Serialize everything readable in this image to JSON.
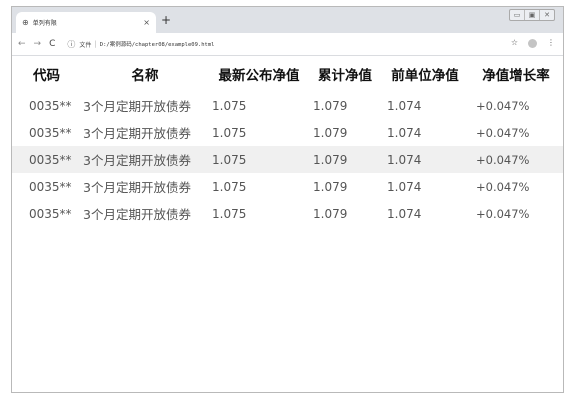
{
  "browser": {
    "tab_title": "单列有限",
    "tab_close": "×",
    "new_tab": "+",
    "url_label": "文件",
    "url": "D:/案例源码/chapter08/example09.html"
  },
  "table": {
    "headers": [
      "代码",
      "名称",
      "最新公布净值",
      "累计净值",
      "前单位净值",
      "净值增长率"
    ],
    "rows": [
      [
        "0035**",
        "3个月定期开放债券",
        "1.075",
        "1.079",
        "1.074",
        "+0.047%"
      ],
      [
        "0035**",
        "3个月定期开放债券",
        "1.075",
        "1.079",
        "1.074",
        "+0.047%"
      ],
      [
        "0035**",
        "3个月定期开放债券",
        "1.075",
        "1.079",
        "1.074",
        "+0.047%"
      ],
      [
        "0035**",
        "3个月定期开放债券",
        "1.075",
        "1.079",
        "1.074",
        "+0.047%"
      ],
      [
        "0035**",
        "3个月定期开放债券",
        "1.075",
        "1.079",
        "1.074",
        "+0.047%"
      ]
    ],
    "highlighted_row": 2,
    "highlight_color": "#f0f0f0"
  }
}
